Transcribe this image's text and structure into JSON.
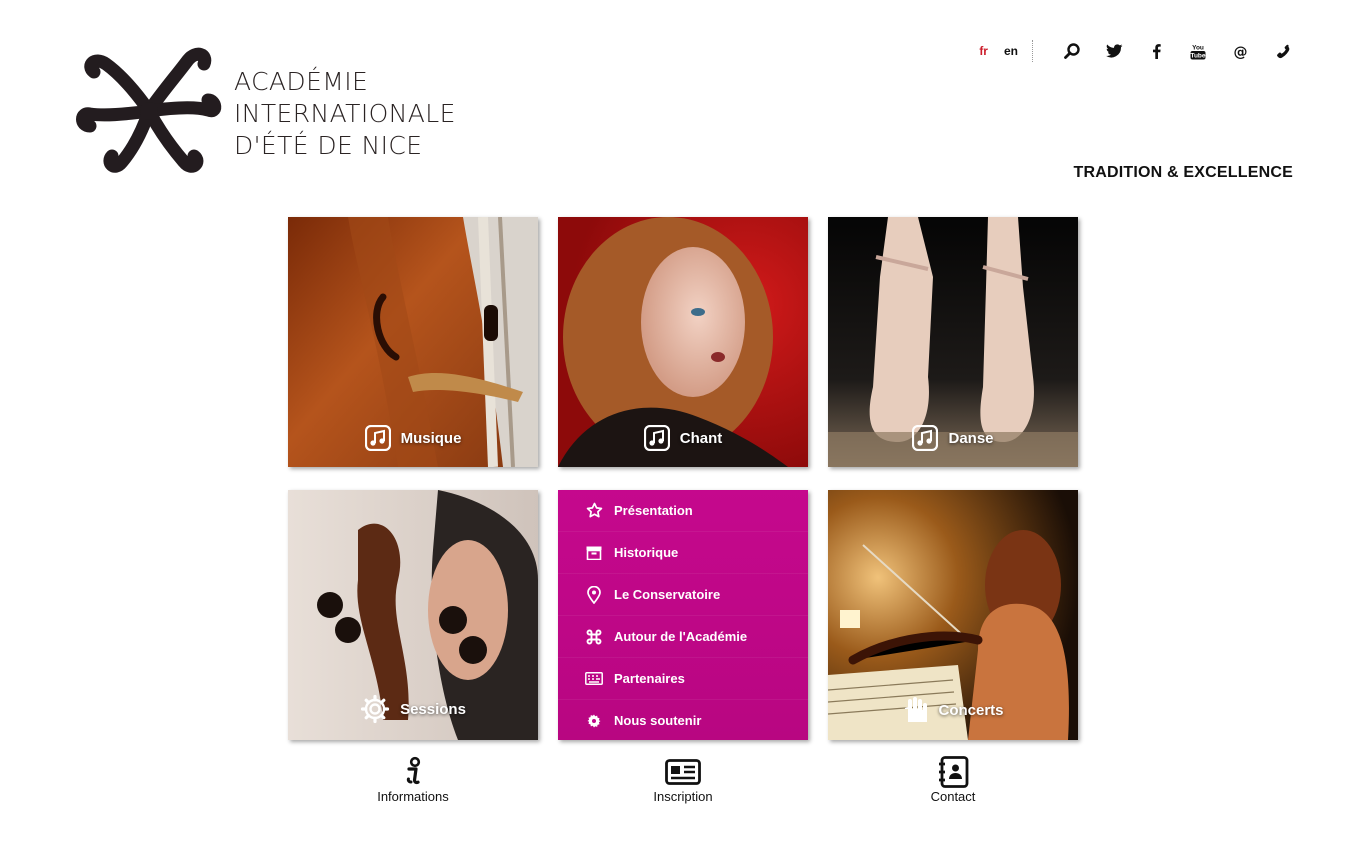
{
  "header": {
    "logo_lines": [
      "ACADÉMIE",
      "INTERNATIONALE",
      "D'ÉTÉ DE NICE"
    ],
    "languages": [
      {
        "code": "fr",
        "active": true
      },
      {
        "code": "en",
        "active": false
      }
    ],
    "top_icons": [
      "search-icon",
      "twitter-icon",
      "facebook-icon",
      "youtube-icon",
      "email-icon",
      "phone-icon"
    ],
    "tagline": "TRADITION & EXCELLENCE"
  },
  "tiles": {
    "musique": {
      "label": "Musique",
      "icon": "music-note-icon"
    },
    "chant": {
      "label": "Chant",
      "icon": "music-note-icon"
    },
    "danse": {
      "label": "Danse",
      "icon": "music-note-icon"
    },
    "sessions": {
      "label": "Sessions",
      "icon": "gear-icon"
    },
    "concerts": {
      "label": "Concerts",
      "icon": "hand-icon"
    }
  },
  "menu": {
    "items": [
      {
        "label": "Présentation",
        "icon": "star-icon"
      },
      {
        "label": "Historique",
        "icon": "archive-icon"
      },
      {
        "label": "Le Conservatoire",
        "icon": "map-pin-icon"
      },
      {
        "label": "Autour de l'Académie",
        "icon": "command-icon"
      },
      {
        "label": "Partenaires",
        "icon": "keyboard-icon"
      },
      {
        "label": "Nous soutenir",
        "icon": "cog-icon"
      }
    ]
  },
  "bottom_links": {
    "informations": {
      "label": "Informations",
      "icon": "info-icon"
    },
    "inscription": {
      "label": "Inscription",
      "icon": "id-card-icon"
    },
    "contact": {
      "label": "Contact",
      "icon": "address-book-icon"
    }
  },
  "colors": {
    "accent_magenta": "#c5088d",
    "active_lang": "#cc1d2b",
    "text": "#111111"
  }
}
